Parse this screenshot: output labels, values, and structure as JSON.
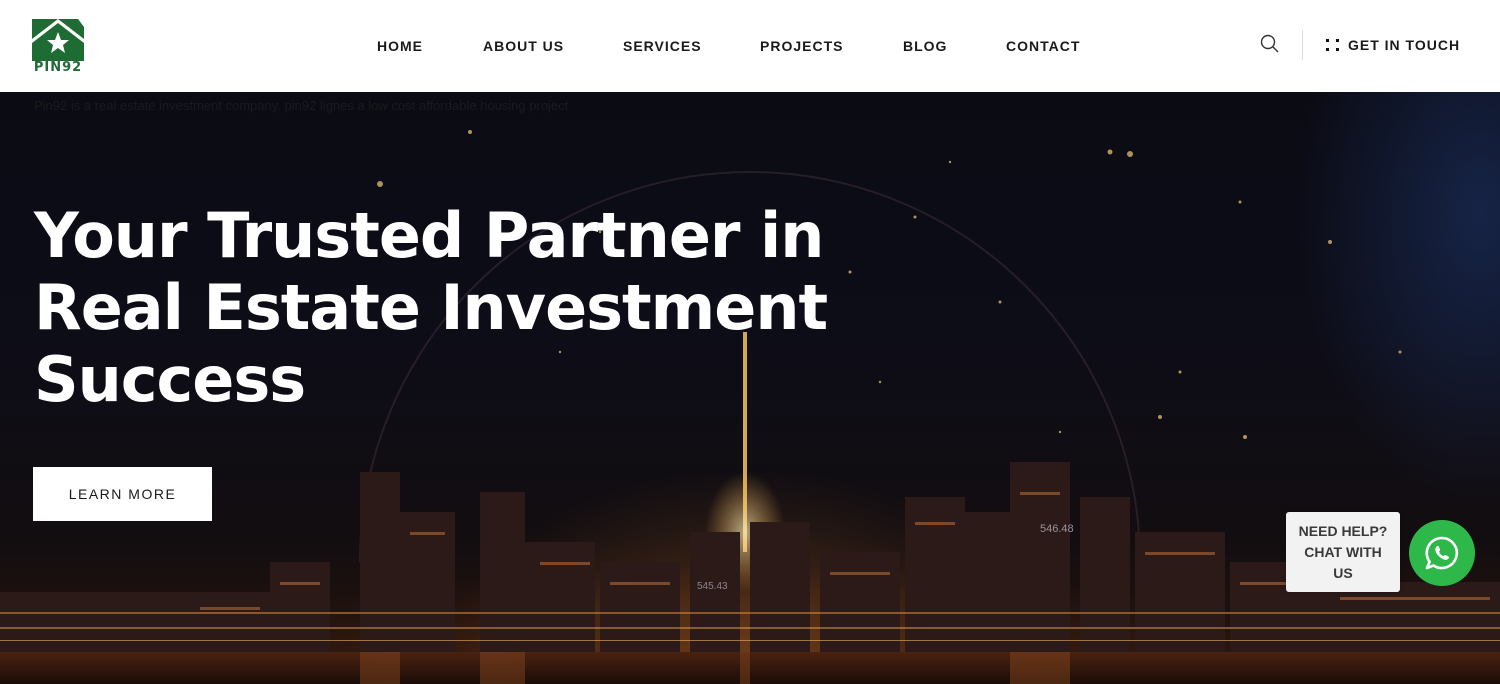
{
  "brand": {
    "logo_text": "PIN92",
    "colors": {
      "green": "#1f6b34",
      "whatsapp": "#2fb84a"
    }
  },
  "nav": {
    "items": [
      {
        "label": "HOME"
      },
      {
        "label": "ABOUT US"
      },
      {
        "label": "SERVICES"
      },
      {
        "label": "PROJECTS"
      },
      {
        "label": "BLOG"
      },
      {
        "label": "CONTACT"
      }
    ],
    "search_icon": "search-icon",
    "cta_label": "GET IN TOUCH",
    "cta_icon": "grid-dots-icon"
  },
  "hero": {
    "ticker": "Pin92 is a real estate investment company. pin92 lignes a low cost affordable housing project",
    "title_lines": [
      "Your Trusted Partner in",
      "Real Estate Investment",
      "Success"
    ],
    "button_label": "LEARN MORE",
    "overlay_numbers": [
      "546.48",
      "545.43"
    ]
  },
  "chat": {
    "lines": [
      "NEED HELP?",
      "CHAT WITH",
      "US"
    ],
    "icon": "whatsapp-icon"
  }
}
